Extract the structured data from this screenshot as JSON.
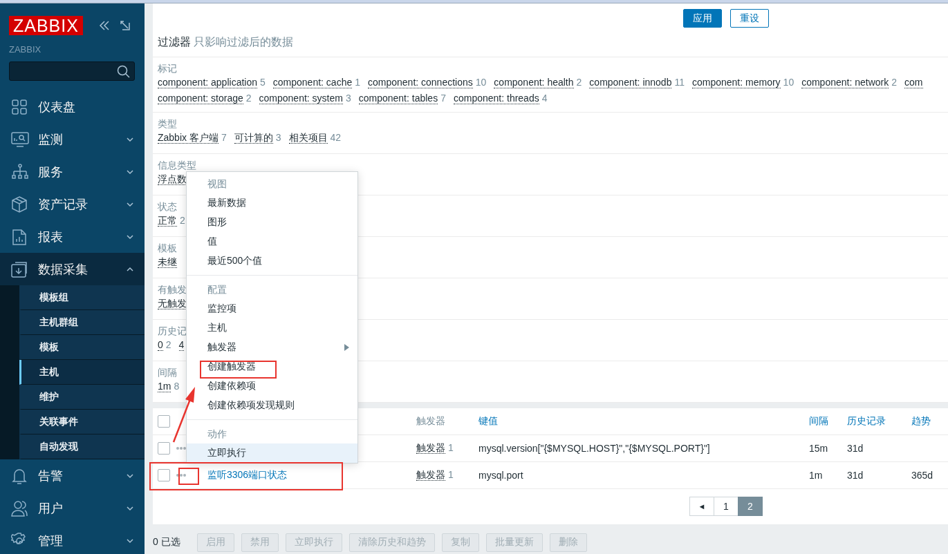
{
  "sidebar": {
    "logo": "ZABBIX",
    "server_name": "ZABBIX",
    "items": [
      {
        "label": "仪表盘",
        "expandable": false,
        "expanded": false
      },
      {
        "label": "监测",
        "expandable": true,
        "expanded": false
      },
      {
        "label": "服务",
        "expandable": true,
        "expanded": false
      },
      {
        "label": "资产记录",
        "expandable": true,
        "expanded": false
      },
      {
        "label": "报表",
        "expandable": true,
        "expanded": false
      },
      {
        "label": "数据采集",
        "expandable": true,
        "expanded": true,
        "children": [
          {
            "label": "模板组",
            "selected": false
          },
          {
            "label": "主机群组",
            "selected": false
          },
          {
            "label": "模板",
            "selected": false
          },
          {
            "label": "主机",
            "selected": true
          },
          {
            "label": "维护",
            "selected": false
          },
          {
            "label": "关联事件",
            "selected": false
          },
          {
            "label": "自动发现",
            "selected": false
          }
        ]
      },
      {
        "label": "告警",
        "expandable": true,
        "expanded": false
      },
      {
        "label": "用户",
        "expandable": true,
        "expanded": false
      },
      {
        "label": "管理",
        "expandable": true,
        "expanded": false
      }
    ]
  },
  "filter": {
    "buttons": [
      {
        "label": "应用",
        "primary": true
      },
      {
        "label": "重设",
        "primary": false
      }
    ],
    "title": "过滤器",
    "subtitle": "只影响过滤后的数据",
    "sections": [
      {
        "label": "标记",
        "lines": [
          [
            {
              "text": "component: application",
              "count": "5"
            },
            {
              "text": "component: cache",
              "count": "1"
            },
            {
              "text": "component: connections",
              "count": "10"
            },
            {
              "text": "component: health",
              "count": "2"
            },
            {
              "text": "component: innodb",
              "count": "11"
            },
            {
              "text": "component: memory",
              "count": "10"
            },
            {
              "text": "component: network",
              "count": "2"
            },
            {
              "text": "com"
            }
          ],
          [
            {
              "text": "component: storage",
              "count": "2"
            },
            {
              "text": "component: system",
              "count": "3"
            },
            {
              "text": "component: tables",
              "count": "7"
            },
            {
              "text": "component: threads",
              "count": "4"
            }
          ]
        ]
      },
      {
        "label": "类型",
        "lines": [
          [
            {
              "text": "Zabbix 客户端",
              "count": "7"
            },
            {
              "text": "可计算的",
              "count": "3"
            },
            {
              "text": "相关项目",
              "count": "42"
            }
          ]
        ]
      },
      {
        "label": "信息类型",
        "lines": [
          [
            {
              "text": "浮点数"
            }
          ]
        ]
      },
      {
        "label": "状态",
        "lines": [
          [
            {
              "text": "正常",
              "count": "2"
            }
          ]
        ]
      },
      {
        "label": "模板",
        "lines": [
          [
            {
              "text": "未继"
            }
          ]
        ]
      },
      {
        "label": "有触发",
        "lines": [
          [
            {
              "text": "无触发"
            }
          ]
        ]
      },
      {
        "label": "历史记",
        "lines": [
          [
            {
              "text": "0",
              "count": "2"
            },
            {
              "text": "4"
            }
          ]
        ]
      },
      {
        "label": "间隔",
        "lines": [
          [
            {
              "text": "1m",
              "count": "8"
            }
          ]
        ]
      }
    ]
  },
  "table": {
    "columns": [
      {
        "label": "触发器",
        "link": false
      },
      {
        "label": "键值",
        "link": true
      },
      {
        "label": "间隔",
        "link": true
      },
      {
        "label": "历史记录",
        "link": true
      },
      {
        "label": "趋势",
        "link": true
      }
    ],
    "rows": [
      {
        "checked": false,
        "triggers": "触发器",
        "trigger_count": "1",
        "key": "mysql.version[\"{$MYSQL.HOST}\",\"{$MYSQL.PORT}\"]",
        "interval": "15m",
        "history": "31d"
      },
      {
        "checked": false,
        "name": "监听3306端口状态",
        "triggers": "触发器",
        "trigger_count": "1",
        "key": "mysql.port",
        "interval": "1m",
        "history": "31d",
        "trends": "365d"
      }
    ],
    "header_checked": false,
    "pagination": [
      {
        "label": "◄",
        "selected": false
      },
      {
        "label": "1",
        "selected": false
      },
      {
        "label": "2",
        "selected": true
      }
    ]
  },
  "footer": {
    "selected_count": "0 已选",
    "buttons": [
      {
        "label": "启用",
        "disabled": true
      },
      {
        "label": "禁用",
        "disabled": true
      },
      {
        "label": "立即执行",
        "disabled": true
      },
      {
        "label": "清除历史和趋势",
        "disabled": true
      },
      {
        "label": "复制",
        "disabled": true
      },
      {
        "label": "批量更新",
        "disabled": true
      },
      {
        "label": "删除",
        "disabled": true
      }
    ]
  },
  "context_menu": {
    "sections": [
      {
        "header": "视图",
        "items": [
          {
            "label": "最新数据",
            "submenu": false,
            "highlighted": false
          },
          {
            "label": "图形",
            "submenu": false,
            "highlighted": false
          },
          {
            "label": "值",
            "submenu": false,
            "highlighted": false
          },
          {
            "label": "最近500个值",
            "submenu": false,
            "highlighted": false
          }
        ]
      },
      {
        "header": "配置",
        "items": [
          {
            "label": "监控项",
            "submenu": false,
            "highlighted": false
          },
          {
            "label": "主机",
            "submenu": false,
            "highlighted": false
          },
          {
            "label": "触发器",
            "submenu": true,
            "highlighted": false
          },
          {
            "label": "创建触发器",
            "submenu": false,
            "highlighted": false
          },
          {
            "label": "创建依赖项",
            "submenu": false,
            "highlighted": false
          },
          {
            "label": "创建依赖项发现规则",
            "submenu": false,
            "highlighted": false
          }
        ]
      },
      {
        "header": "动作",
        "items": [
          {
            "label": "立即执行",
            "submenu": false,
            "highlighted": true
          }
        ]
      }
    ]
  }
}
